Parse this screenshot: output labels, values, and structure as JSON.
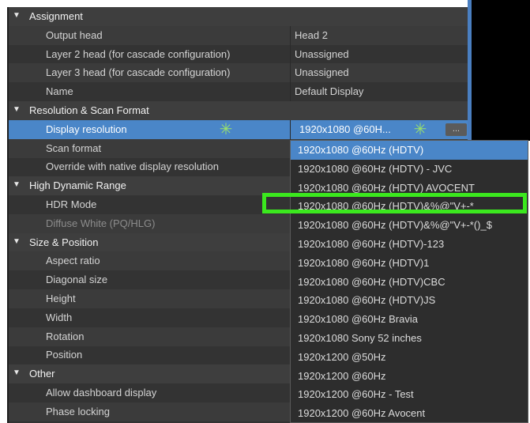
{
  "sections": [
    {
      "title": "Assignment",
      "rows": [
        {
          "label": "Output head",
          "value": "Head 2"
        },
        {
          "label": "Layer 2 head (for cascade configuration)",
          "value": "Unassigned"
        },
        {
          "label": "Layer 3 head (for cascade configuration)",
          "value": "Unassigned"
        },
        {
          "label": "Name",
          "value": "Default Display"
        }
      ]
    },
    {
      "title": "Resolution & Scan Format",
      "rows": [
        {
          "label": "Display resolution",
          "value": "1920x1080 @60H...",
          "button": "..."
        },
        {
          "label": "Scan format",
          "value": ""
        },
        {
          "label": "Override with native display resolution",
          "value": ""
        }
      ]
    },
    {
      "title": "High Dynamic Range",
      "rows": [
        {
          "label": "HDR Mode",
          "value": ""
        },
        {
          "label": "Diffuse White (PQ/HLG)",
          "value": ""
        }
      ]
    },
    {
      "title": "Size & Position",
      "rows": [
        {
          "label": "Aspect ratio",
          "value": ""
        },
        {
          "label": "Diagonal size",
          "value": ""
        },
        {
          "label": "Height",
          "value": ""
        },
        {
          "label": "Width",
          "value": ""
        },
        {
          "label": "Rotation",
          "value": ""
        },
        {
          "label": "Position",
          "value": ""
        }
      ]
    },
    {
      "title": "Other",
      "rows": [
        {
          "label": "Allow dashboard display",
          "value": ""
        },
        {
          "label": "Phase locking",
          "value": ""
        }
      ]
    }
  ],
  "dropdown": {
    "selected_index": 0,
    "highlighted_index": 4,
    "options": [
      "1920x1080 @60Hz (HDTV)",
      "1920x1080 @60Hz (HDTV) - JVC",
      "1920x1080 @60Hz (HDTV) AVOCENT",
      "1920x1080 @60Hz (HDTV)&%@\"V+-*",
      "1920x1080 @60Hz (HDTV)&%@\"V+-*()_$",
      "1920x1080 @60Hz (HDTV)-123",
      "1920x1080 @60Hz (HDTV)1",
      "1920x1080 @60Hz (HDTV)CBC",
      "1920x1080 @60Hz (HDTV)JS",
      "1920x1080 @60Hz Bravia",
      "1920x1080 Sony 52 inches",
      "1920x1200 @50Hz",
      "1920x1200 @60Hz",
      "1920x1200 @60Hz - Test",
      "1920x1200 @60Hz Avocent"
    ]
  },
  "icons": {
    "section_toggle": "triangle-down-icon",
    "spark": "green-sparkle-icon"
  },
  "colors": {
    "panel_bg": "#333333",
    "selection": "#4a86c8",
    "highlight_box": "#3be81e",
    "sparkle": "#9be26a"
  }
}
